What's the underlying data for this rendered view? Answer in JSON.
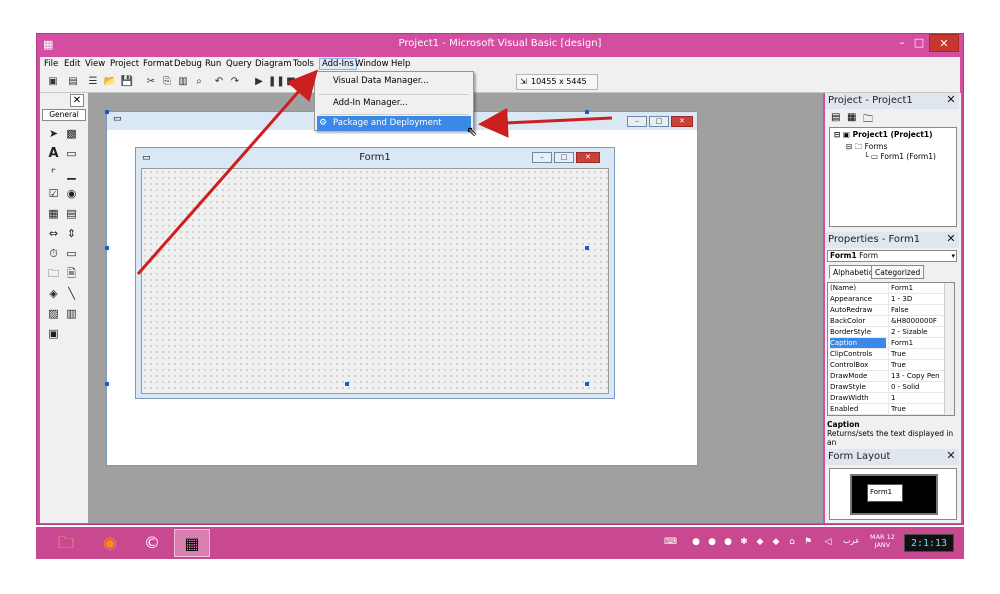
{
  "window": {
    "title": "Project1 - Microsoft Visual Basic [design]",
    "min_label": "–",
    "max_label": "□",
    "close_label": "✕"
  },
  "menu": [
    {
      "label": "File"
    },
    {
      "label": "Edit"
    },
    {
      "label": "View"
    },
    {
      "label": "Project"
    },
    {
      "label": "Format"
    },
    {
      "label": "Debug"
    },
    {
      "label": "Run"
    },
    {
      "label": "Query"
    },
    {
      "label": "Diagram"
    },
    {
      "label": "Tools"
    },
    {
      "label": "Add-Ins"
    },
    {
      "label": "Window"
    },
    {
      "label": "Help"
    }
  ],
  "toolbar": {
    "size_readout": "10455 x 5445"
  },
  "toolbox": {
    "tab_label": "General",
    "close_label": "✕"
  },
  "addins_menu": {
    "items": [
      {
        "label": "Visual Data Manager..."
      },
      {
        "label": "Add-In Manager..."
      },
      {
        "label": "Package and Deployment Wizard..."
      }
    ]
  },
  "form_designer": {
    "caption": "Form1",
    "outer_caption": ""
  },
  "project_panel": {
    "title": "Project - Project1",
    "tree": [
      {
        "label": "Project1 (Project1)"
      },
      {
        "label": "Forms"
      },
      {
        "label": "Form1 (Form1)"
      }
    ]
  },
  "properties_panel": {
    "title": "Properties - Form1",
    "object_name": "Form1",
    "object_type": "Form",
    "tabs": [
      {
        "label": "Alphabetic"
      },
      {
        "label": "Categorized"
      }
    ],
    "rows": [
      {
        "name": "(Name)",
        "value": "Form1"
      },
      {
        "name": "Appearance",
        "value": "1 - 3D"
      },
      {
        "name": "AutoRedraw",
        "value": "False"
      },
      {
        "name": "BackColor",
        "value": "&H8000000F"
      },
      {
        "name": "BorderStyle",
        "value": "2 - Sizable"
      },
      {
        "name": "Caption",
        "value": "Form1"
      },
      {
        "name": "ClipControls",
        "value": "True"
      },
      {
        "name": "ControlBox",
        "value": "True"
      },
      {
        "name": "DrawMode",
        "value": "13 - Copy Pen"
      },
      {
        "name": "DrawStyle",
        "value": "0 - Solid"
      },
      {
        "name": "DrawWidth",
        "value": "1"
      },
      {
        "name": "Enabled",
        "value": "True"
      }
    ],
    "selected_row": "Caption",
    "description_title": "Caption",
    "description_text": "Returns/sets the text displayed in an"
  },
  "layout_panel": {
    "title": "Form Layout",
    "form_label": "Form1"
  },
  "taskbar": {
    "lang": "عرب",
    "date_line1": "MAR 12",
    "date_line2": "JANV",
    "clock": "2:1:13"
  },
  "colors": {
    "window_frame": "#d34da1",
    "taskbar": "#c8498f",
    "highlight": "#3a89e8",
    "arrow": "#cc1f1f"
  }
}
